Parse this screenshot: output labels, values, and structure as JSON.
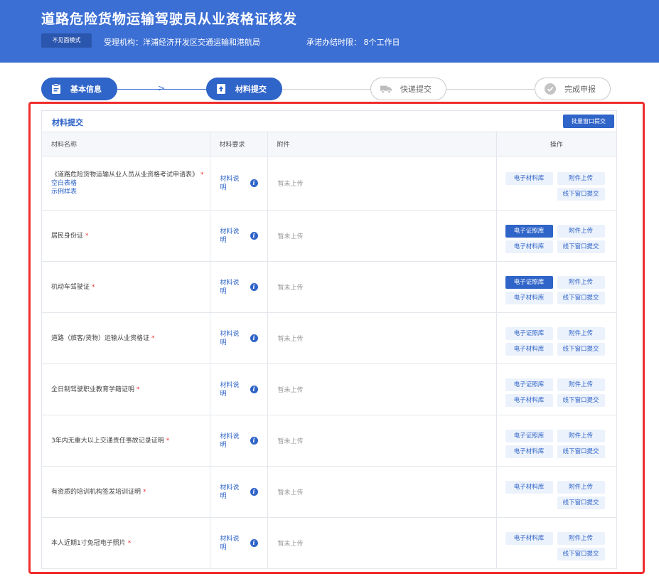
{
  "header": {
    "title": "道路危险货物运输驾驶员从业资格证核发",
    "mode_button": "不见面模式",
    "agency": "受理机构：洋浦经济开发区交通运输和港航局",
    "deadline": "承诺办结时限：  8个工作日"
  },
  "steps": [
    {
      "label": "基本信息",
      "state": "done",
      "icon": "clipboard-icon"
    },
    {
      "label": "材料提交",
      "state": "active",
      "icon": "upload-icon"
    },
    {
      "label": "快递提交",
      "state": "pending",
      "icon": "truck-icon"
    },
    {
      "label": "完成申报",
      "state": "pending",
      "icon": "check-circle-icon"
    }
  ],
  "panel": {
    "title": "材料提交",
    "batch_button": "批量窗口提交"
  },
  "table": {
    "headers": {
      "name": "材料名称",
      "requirement": "材料要求",
      "attachment": "附件",
      "operation": "操作"
    },
    "rows": [
      {
        "name": "《道路危险货物运输从业人员从业资格考试申请表》",
        "required_mark": "*",
        "links": [
          "空白表格",
          "示例样表"
        ],
        "requirement": "材料说明",
        "attachment": "暂未上传",
        "buttons": [
          "电子材料库",
          "附件上传",
          "线下窗口提交"
        ]
      },
      {
        "name": "居民身份证",
        "required_mark": "*",
        "requirement": "材料说明",
        "attachment": "暂未上传",
        "buttons": [
          "电子证照库",
          "附件上传",
          "电子材料库",
          "线下窗口提交"
        ]
      },
      {
        "name": "机动车驾驶证",
        "required_mark": "*",
        "requirement": "材料说明",
        "attachment": "暂未上传",
        "buttons": [
          "电子证照库",
          "附件上传",
          "电子材料库",
          "线下窗口提交"
        ]
      },
      {
        "name": "道路（旅客/货物）运输从业资格证",
        "required_mark": "*",
        "requirement": "材料说明",
        "attachment": "暂未上传",
        "buttons": [
          "电子证照库",
          "附件上传",
          "电子材料库",
          "线下窗口提交"
        ]
      },
      {
        "name": "全日制驾驶职业教育学籍证明",
        "required_mark": "*",
        "requirement": "材料说明",
        "attachment": "暂未上传",
        "buttons": [
          "电子证照库",
          "附件上传",
          "电子材料库",
          "线下窗口提交"
        ]
      },
      {
        "name": "3年内无重大以上交通责任事故记录证明",
        "required_mark": "*",
        "requirement": "材料说明",
        "attachment": "暂未上传",
        "buttons": [
          "电子证照库",
          "附件上传",
          "电子材料库",
          "线下窗口提交"
        ]
      },
      {
        "name": "有资质的培训机构签发培训证明",
        "required_mark": "*",
        "requirement": "材料说明",
        "attachment": "暂未上传",
        "buttons": [
          "电子材料库",
          "附件上传",
          "线下窗口提交"
        ]
      },
      {
        "name": "本人近期1寸免冠电子照片",
        "required_mark": "*",
        "requirement": "材料说明",
        "attachment": "暂未上传",
        "buttons": [
          "电子材料库",
          "附件上传",
          "线下窗口提交"
        ]
      }
    ]
  },
  "colors": {
    "brand": "#3c6fd4",
    "primary": "#2f64c8",
    "highlight_frame": "#f02c2c",
    "required": "#ee3333"
  }
}
